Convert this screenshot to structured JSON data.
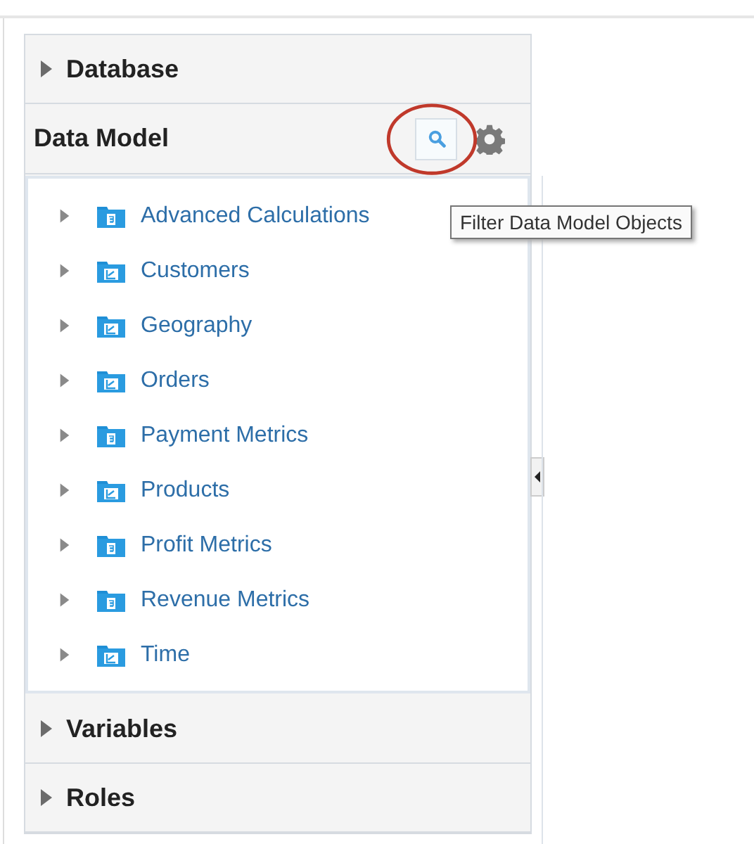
{
  "sections_top": [
    {
      "label": "Database",
      "expanded": false
    }
  ],
  "data_model": {
    "title": "Data Model",
    "filter_tooltip": "Filter Data Model Objects",
    "items": [
      {
        "label": "Advanced Calculations",
        "kind": "measure",
        "expanded": false
      },
      {
        "label": "Customers",
        "kind": "dimension",
        "expanded": false
      },
      {
        "label": "Geography",
        "kind": "dimension",
        "expanded": false
      },
      {
        "label": "Orders",
        "kind": "dimension",
        "expanded": false
      },
      {
        "label": "Payment Metrics",
        "kind": "measure",
        "expanded": false
      },
      {
        "label": "Products",
        "kind": "dimension",
        "expanded": false
      },
      {
        "label": "Profit Metrics",
        "kind": "measure",
        "expanded": false
      },
      {
        "label": "Revenue Metrics",
        "kind": "measure",
        "expanded": false
      },
      {
        "label": "Time",
        "kind": "dimension",
        "expanded": false
      }
    ]
  },
  "sections_bottom": [
    {
      "label": "Variables",
      "expanded": false
    },
    {
      "label": "Roles",
      "expanded": false
    }
  ]
}
